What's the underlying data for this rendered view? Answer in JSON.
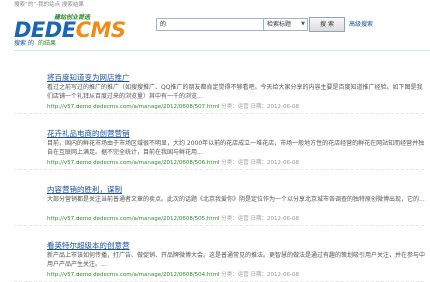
{
  "breadcrumb": "搜索“的”-我的站点 搜索结果",
  "logo": {
    "slogan": "建站创业首选",
    "part1": "DEDE",
    "part2": "CMS"
  },
  "search": {
    "query": "的",
    "select_value": "检索标题",
    "button_label": "搜 索",
    "advanced_link": "高级搜索"
  },
  "subbar": {
    "prefix": "搜索",
    "keyword": "的",
    "suffix": "的结果"
  },
  "results": [
    {
      "title": "将百度知道变为网店推广",
      "desc": "看过之前写过的推广的推广（如搜搜推广、QQ推广的朋友都肯定觉得不够看吧。今天给大家分享的内容主要是百度知道推广经验。如下图是我们店铺一个礼拜从百度过来的浏览量）其中有一千的浏览...",
      "url": "http://v57.demo.dedecms.com/a/manage/2012/0608/507.html",
      "category": "分类：运营",
      "date_label": "日期：2012-06-08"
    },
    {
      "title": "花卉礼品电商的创营营销",
      "desc": "目前，国内的鲜花市场由于市场区域很不明显，大约 2000年以前的花店成立一堆花店，市场一般地方性的花店经营的鲜花在网站知而经营并独自在互联网上满足。据不完全统计，目前在我国与鲜花用...",
      "url": "http://v57.demo.dedecms.com/a/manage/2012/0608/506.html",
      "category": "分类：运营",
      "date_label": "日期：2012-06-08"
    },
    {
      "title": "内容营销的胜利，谋制",
      "desc": "大部分营销都是关注当前普通者文章的卖点。此次的话题《北京我爱你》阴是定位作为一个以分享北京城市各调查的独特原创微博出现，它的...",
      "url": "http://v57.demo.dedecms.com/a/manage/2012/0608/505.html",
      "category": "分类：运营",
      "date_label": "日期：2012-06-08"
    },
    {
      "title": "看英特尔超级本的创意营",
      "desc": "新产品上市该如何传播，打广告、做促销、开品牌微博大会。这是普通常见的推法。更智慧的做法是通过有趣的策划吸引用户关注，并在参与中用户产品产生关注。...",
      "url": "http://v57.demo.dedecms.com/a/manage/2012/0608/504.html",
      "category": "分类：运营",
      "date_label": "日期：2012-06-08"
    }
  ]
}
